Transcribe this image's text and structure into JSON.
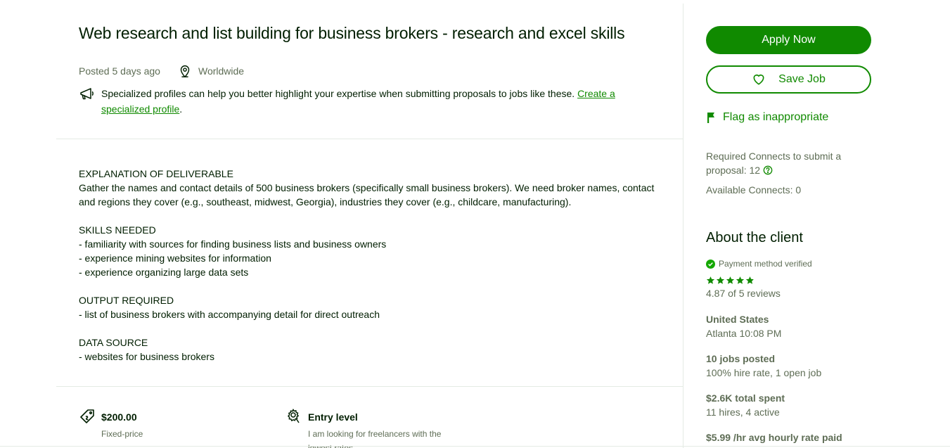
{
  "job": {
    "title": "Web research and list building for business brokers - research and excel skills",
    "posted": "Posted 5 days ago",
    "location": "Worldwide",
    "specialized_text": "Specialized profiles can help you better highlight your expertise when submitting proposals to jobs like these. ",
    "specialized_link": "Create a specialized profile",
    "specialized_end": "."
  },
  "description": {
    "p1": "EXPLANATION OF DELIVERABLE",
    "p2": "Gather the names and contact details of 500 business brokers (specifically small business brokers). We need broker names, contact and regions they cover (e.g., southeast, midwest, Georgia), industries they cover (e.g., childcare, manufacturing).",
    "p3": "SKILLS NEEDED",
    "p4": "- familiarity with sources for finding business lists and business owners",
    "p5": "- experience mining websites for information",
    "p6": "- experience organizing large data sets",
    "p7": "OUTPUT REQUIRED",
    "p8": "- list of business brokers with accompanying detail for direct outreach",
    "p9": "DATA SOURCE",
    "p10": "- websites for business brokers"
  },
  "features": {
    "price": "$200.00",
    "price_type": "Fixed-price",
    "level": "Entry level",
    "level_desc": "I am looking for freelancers with the lowest rates"
  },
  "sidebar": {
    "apply_label": "Apply Now",
    "save_label": "Save Job",
    "flag_label": "Flag as inappropriate",
    "connects_required": "Required Connects to submit a proposal: 12",
    "connects_available": "Available Connects: 0"
  },
  "client": {
    "heading": "About the client",
    "payment": "Payment method verified",
    "rating": 4.87,
    "reviews": "4.87 of 5 reviews",
    "country": "United States",
    "city_time": "Atlanta 10:08 PM",
    "jobs_posted": "10 jobs posted",
    "hire_rate": "100% hire rate, 1 open job",
    "total_spent": "$2.6K total spent",
    "hires": "11 hires, 4 active",
    "avg_rate": "$5.99 /hr avg hourly rate paid"
  },
  "colors": {
    "brand_green": "#108a00",
    "text_dark": "#001e00",
    "text_muted": "#5e6d55",
    "divider": "#e4ebe4"
  },
  "icons": {
    "location": "map-pin-icon",
    "megaphone": "megaphone-icon",
    "heart": "heart-icon",
    "flag": "flag-icon",
    "question": "question-icon",
    "verified": "verified-check-icon",
    "star": "star-icon",
    "tag": "price-tag-icon",
    "level": "experience-level-icon"
  }
}
